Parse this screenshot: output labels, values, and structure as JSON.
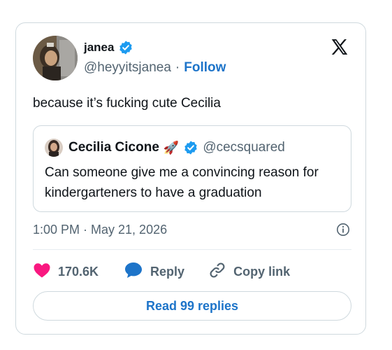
{
  "tweet": {
    "author": {
      "name": "janea",
      "handle": "@heyyitsjanea",
      "follow_label": "Follow",
      "separator": "·"
    },
    "text": "because it’s fucking cute Cecilia",
    "quoted": {
      "name": "Cecilia Cicone",
      "emoji": "🚀",
      "handle": "@cecsquared",
      "text": "Can someone give me a convincing reason for kindergarteners to have a graduation"
    },
    "timestamp": "1:00 PM · May 21, 2026",
    "actions": {
      "likes": "170.6K",
      "reply_label": "Reply",
      "copy_link_label": "Copy link"
    },
    "read_replies_label": "Read 99 replies"
  },
  "colors": {
    "brand_blue": "#1d74c9",
    "verified_blue": "#1d9bf0",
    "like_pink": "#f91880",
    "muted_text": "#536471",
    "border": "#cfd9de"
  },
  "icons": {
    "verified": "verified-badge-icon",
    "x_logo": "x-logo-icon",
    "info": "info-icon",
    "heart": "heart-icon",
    "reply": "reply-bubble-icon",
    "link": "link-icon"
  }
}
